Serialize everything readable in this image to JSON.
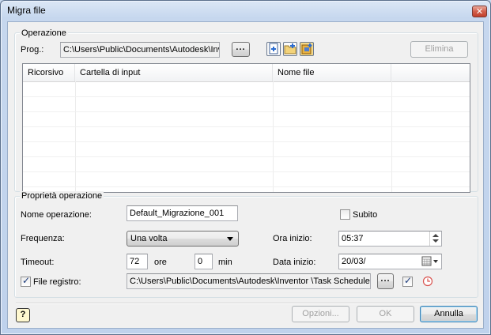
{
  "window": {
    "title": "Migra file",
    "close_glyph": "✕"
  },
  "operazione": {
    "legend": "Operazione",
    "prog_label": "Prog.:",
    "prog_value": "C:\\Users\\Public\\Documents\\Autodesk\\Inventor",
    "browse_label": "...",
    "elimina_label": "Elimina",
    "icons": [
      "add-file-icon",
      "add-folder-icon",
      "add-project-icon"
    ],
    "table": {
      "columns": [
        "Ricorsivo",
        "Cartella di input",
        "Nome file",
        ""
      ],
      "rows": []
    }
  },
  "proprieta": {
    "legend": "Proprietà operazione",
    "nome_label": "Nome operazione:",
    "nome_value": "Default_Migrazione_001",
    "subito_label": "Subito",
    "subito_checked": false,
    "frequenza_label": "Frequenza:",
    "frequenza_value": "Una volta",
    "ora_label": "Ora inizio:",
    "ora_value": "05:37",
    "timeout_label": "Timeout:",
    "timeout_hours": "72",
    "ore_label": "ore",
    "timeout_minutes": "0",
    "min_label": "min",
    "data_label": "Data inizio:",
    "data_value": "20/03/",
    "registro_label": "File registro:",
    "registro_checked": true,
    "registro_value": "C:\\Users\\Public\\Documents\\Autodesk\\Inventor                \\Task Scheduler",
    "browse_label": "...",
    "extra_checked": true
  },
  "footer": {
    "help_glyph": "?",
    "opzioni_label": "Opzioni...",
    "ok_label": "OK",
    "annulla_label": "Annulla"
  },
  "colors": {
    "title_bar": "#c6d7ee",
    "dialog_bg": "#f0f0f0",
    "close_button": "#c94a37",
    "default_button_border": "#3c7fb1"
  }
}
